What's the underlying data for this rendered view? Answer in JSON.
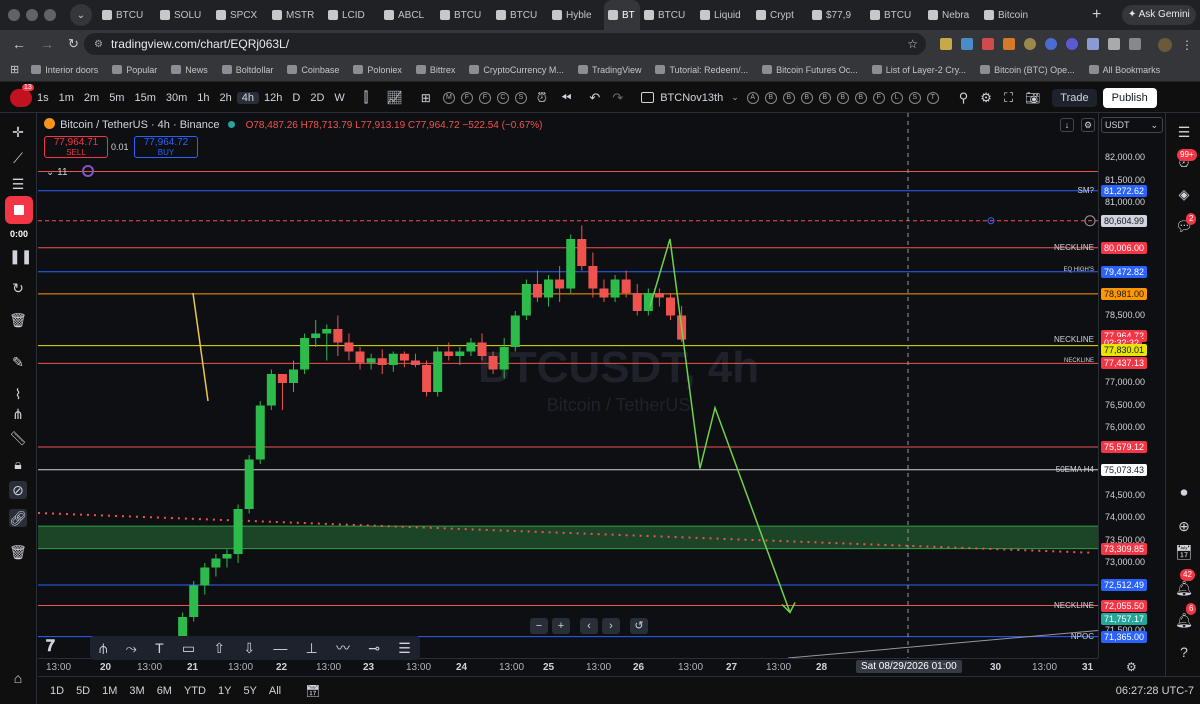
{
  "browser": {
    "tabs": [
      "BTCU",
      "SOLU",
      "SPCX",
      "MSTR",
      "LCID",
      "ABCL",
      "BTCU",
      "BTCU",
      "Hyble",
      "BT",
      "BTCU",
      "Liquid",
      "Crypt",
      "$77,9",
      "BTCU",
      "Nebra",
      "Bitcoin"
    ],
    "ask_gemini": "Ask Gemini",
    "url": "tradingview.com/chart/EQRj063L/",
    "bookmarks": [
      "Interior doors",
      "Popular",
      "News",
      "Boltdollar",
      "Coinbase",
      "Poloniex",
      "Bittrex",
      "CryptoCurrency M...",
      "TradingView",
      "Tutorial: Redeem/...",
      "Bitcoin Futures Oc...",
      "List of Layer-2 Cry...",
      "Bitcoin (BTC) Ope...",
      "All Bookmarks"
    ]
  },
  "toolbar": {
    "timeframes": [
      "1s",
      "1m",
      "2m",
      "5m",
      "15m",
      "30m",
      "1h",
      "2h",
      "4h",
      "12h",
      "D",
      "2D",
      "W"
    ],
    "active_timeframe": "4h",
    "circle_buttons": [
      "M",
      "F",
      "F",
      "C",
      "S"
    ],
    "layout_name": "BTCNov13th",
    "layout_circles": [
      "A",
      "B",
      "B",
      "B",
      "B",
      "B",
      "B",
      "F",
      "L",
      "S",
      "T"
    ],
    "trade": "Trade",
    "publish": "Publish"
  },
  "recorder": {
    "time": "0:00"
  },
  "legend": {
    "symbol": "Bitcoin / TetherUS · 4h · Binance",
    "ohlc": "O78,487.26 H78,713.79 L77,913.19 C77,964.72 −522.54 (−0.67%)",
    "sell_price": "77,964.71",
    "sell_label": "SELL",
    "spread": "0.01",
    "buy_price": "77,964.72",
    "buy_label": "BUY",
    "indicator_count": "11"
  },
  "watermark": {
    "symbol": "BTCUSDT, 4h",
    "name": "Bitcoin / TetherUS"
  },
  "price_axis": {
    "currency": "USDT",
    "ticks": [
      "82,000.00",
      "81,500.00",
      "81,000.00",
      "78,500.00",
      "77,000.00",
      "76,500.00",
      "76,000.00",
      "74,500.00",
      "74,000.00",
      "73,500.00",
      "73,000.00",
      "71,500.00"
    ],
    "tags": [
      "81,272.62",
      "80,604.99",
      "80,006.00",
      "79,472.82",
      "78,981.00",
      "77,964.72",
      "02:32:32",
      "77,830.01",
      "77,437.13",
      "75,579.12",
      "75,073.43",
      "73,309.85",
      "72,512.49",
      "72,055.50",
      "71,757.17",
      "71,365.00"
    ]
  },
  "levels": [
    "SM?",
    "NECKLINE",
    "EQ HIGH'S",
    "NECKLINE",
    "NECKLINE",
    "50EMA H4",
    "NECKLINE",
    "NPOC"
  ],
  "time_axis": {
    "labels": [
      "13:00",
      "20",
      "13:00",
      "21",
      "13:00",
      "22",
      "13:00",
      "23",
      "13:00",
      "24",
      "13:00",
      "25",
      "13:00",
      "26",
      "13:00",
      "27",
      "13:00",
      "28",
      "30",
      "13:00",
      "31"
    ],
    "cursor_time": "Sat 08/29/2026  01:00"
  },
  "bottom": {
    "ranges": [
      "1D",
      "5D",
      "1M",
      "3M",
      "6M",
      "YTD",
      "1Y",
      "5Y",
      "All"
    ],
    "clock": "06:27:28 UTC-7"
  },
  "right_badges": {
    "alerts": "99+",
    "chat": "2",
    "notif1": "42",
    "notif2": "6"
  },
  "colors": {
    "up": "#26a69a",
    "up_fill": "#2dbc4c",
    "down": "#ef5350",
    "projection": "#6fd24a",
    "buy": "#2962ff",
    "sell": "#f23645"
  }
}
